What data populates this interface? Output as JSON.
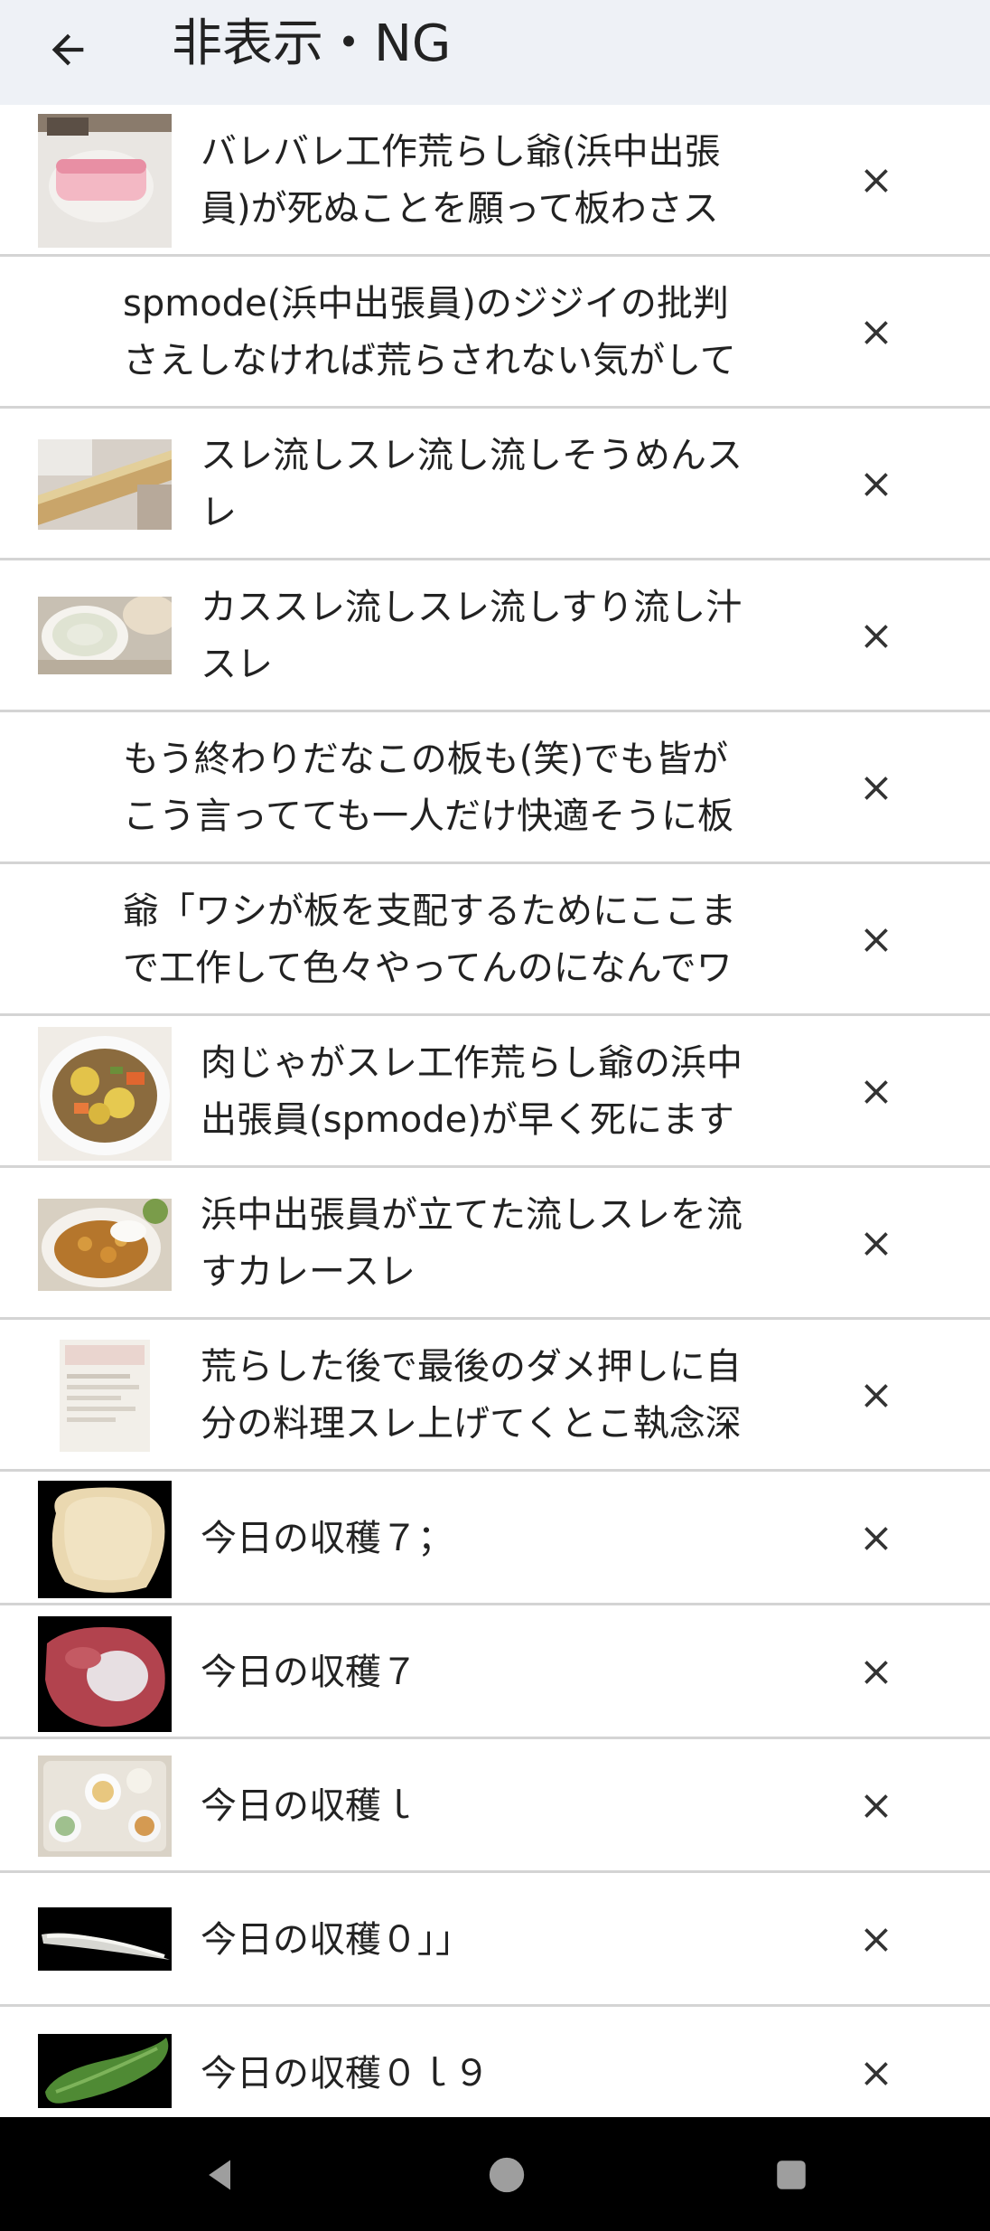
{
  "appbar": {
    "title": "非表示・NG",
    "back_icon": "arrow-left-icon"
  },
  "items": [
    {
      "text": "バレバレ工作荒らし爺(浜中出張\n員)が死ぬことを願って板わさス",
      "thumbnail": "kamaboko-plate"
    },
    {
      "text": "spmode(浜中出張員)のジジイの批判\nさえしなければ荒らされない気がして",
      "thumbnail": ""
    },
    {
      "text": "スレ流しスレ流し流しそうめんス\nレ",
      "thumbnail": "somen-bamboo"
    },
    {
      "text": "カススレ流しスレ流しすり流し汁\nスレ",
      "thumbnail": "soup-bowl"
    },
    {
      "text": "もう終わりだなこの板も(笑)でも皆が\nこう言ってても一人だけ快適そうに板",
      "thumbnail": ""
    },
    {
      "text": "爺「ワシが板を支配するためにここま\nで工作して色々やってんのになんでワ",
      "thumbnail": ""
    },
    {
      "text": "肉じゃがスレ工作荒らし爺の浜中\n出張員(spmode)が早く死にます",
      "thumbnail": "nikujaga-bowl"
    },
    {
      "text": "浜中出張員が立てた流しスレを流\nすカレースレ",
      "thumbnail": "curry-plate"
    },
    {
      "text": "荒らした後で最後のダメ押しに自\n分の料理スレ上げてくとこ執念深",
      "thumbnail": "recipe-page"
    },
    {
      "text": "今日の収穫７；",
      "thumbnail": "bread-slice"
    },
    {
      "text": "今日の収穫７",
      "thumbnail": "raw-meat"
    },
    {
      "text": "今日の収穫ｌ",
      "thumbnail": "meal-tray"
    },
    {
      "text": "今日の収穫０」」",
      "thumbnail": "fish-fillet"
    },
    {
      "text": "今日の収穫０ｌ９",
      "thumbnail": "cucumber"
    }
  ],
  "delete_icon": "close-icon",
  "navbar": {
    "back_icon": "triangle-back-icon",
    "home_icon": "circle-home-icon",
    "recents_icon": "square-recents-icon"
  },
  "colors": {
    "appbar_bg": "#eef1f6",
    "divider": "#d4d4d4",
    "navbar_bg": "#000000",
    "nav_icon": "#9e9e9e"
  }
}
